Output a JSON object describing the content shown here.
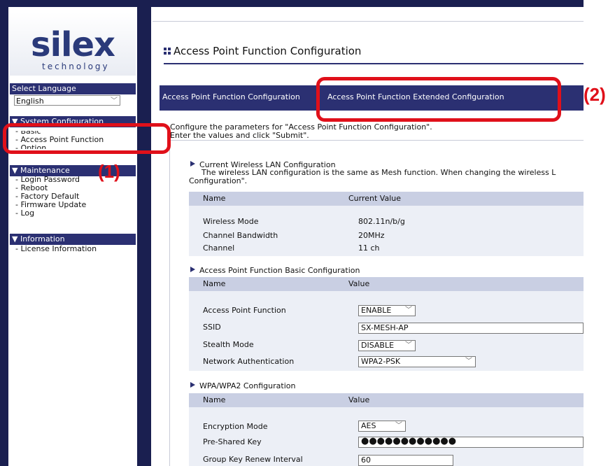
{
  "sidebar": {
    "logo_word": "silex",
    "logo_sub": "technology",
    "select_language_label": "Select Language",
    "language_value": "English",
    "section_system": "▼ System Configuration",
    "item_basic": "- Basic",
    "item_access_point": "- Access Point Function",
    "item_option": "- Option",
    "section_maintenance": "▼ Maintenance",
    "item_login_password": "- Login Password",
    "item_reboot": "- Reboot",
    "item_factory_default": "- Factory Default",
    "item_firmware_update": "- Firmware Update",
    "item_log": "- Log",
    "section_information": "▼ Information",
    "item_license": "- License Information"
  },
  "main": {
    "title": "Access Point Function Configuration",
    "tabs": [
      {
        "label": "Access Point Function Configuration"
      },
      {
        "label": "Access Point Function Extended Configuration"
      }
    ],
    "intro_line1": "Configure the parameters for \"Access Point Function Configuration\".",
    "intro_line2": "Enter the values and click \"Submit\"."
  },
  "current_wireless": {
    "heading": "Current Wireless LAN Configuration",
    "note_line1": "The wireless LAN configuration is the same as Mesh function. When changing the wireless L",
    "note_line2": "Configuration\".",
    "col_name": "Name",
    "col_value": "Current Value",
    "rows": [
      {
        "name": "Wireless Mode",
        "value": "802.11n/b/g"
      },
      {
        "name": "Channel Bandwidth",
        "value": "20MHz"
      },
      {
        "name": "Channel",
        "value": "11 ch"
      }
    ]
  },
  "basic_config": {
    "heading": "Access Point Function Basic Configuration",
    "col_name": "Name",
    "col_value": "Value",
    "rows": [
      {
        "name": "Access Point Function",
        "value": "ENABLE"
      },
      {
        "name": "SSID",
        "value": "SX-MESH-AP"
      },
      {
        "name": "Stealth Mode",
        "value": "DISABLE"
      },
      {
        "name": "Network Authentication",
        "value": "WPA2-PSK"
      }
    ]
  },
  "wpa_config": {
    "heading": "WPA/WPA2 Configuration",
    "col_name": "Name",
    "col_value": "Value",
    "rows": [
      {
        "name": "Encryption Mode",
        "value": "AES"
      },
      {
        "name": "Pre-Shared Key",
        "value": "●●●●●●●●●●●●"
      },
      {
        "name": "Group Key Renew Interval",
        "value": "60"
      }
    ]
  },
  "annotations": {
    "label1": "(1)",
    "label2": "(2)"
  },
  "colors": {
    "frame": "#1a1f50",
    "nav": "#2b3072",
    "annotation": "#e0101a"
  }
}
